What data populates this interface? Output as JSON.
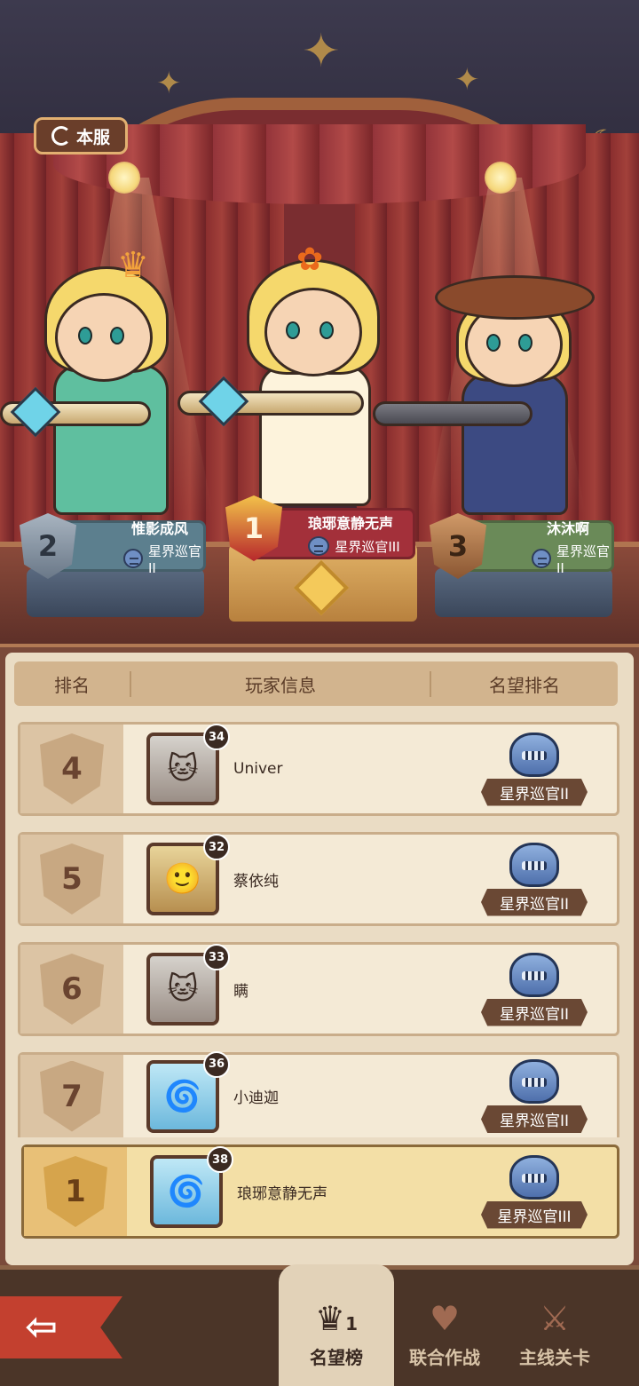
{
  "server_button": {
    "label": "本服"
  },
  "podium": {
    "first": {
      "rank": "1",
      "name": "琅琊意静无声",
      "title": "星界巡官III"
    },
    "second": {
      "rank": "2",
      "name": "惟影成风",
      "title": "星界巡官II"
    },
    "third": {
      "rank": "3",
      "name": "沐沐啊",
      "title": "星界巡官II"
    }
  },
  "list_header": {
    "rank": "排名",
    "info": "玩家信息",
    "fame": "名望排名"
  },
  "rows": [
    {
      "rank": "4",
      "level": "34",
      "name": "Univer",
      "title": "星界巡官II",
      "avatar": "gray-cat"
    },
    {
      "rank": "5",
      "level": "32",
      "name": "蔡依纯",
      "title": "星界巡官II",
      "avatar": "blonde-boy"
    },
    {
      "rank": "6",
      "level": "33",
      "name": "瞒",
      "title": "星界巡官II",
      "avatar": "gray-cat"
    },
    {
      "rank": "7",
      "level": "36",
      "name": "小迪迦",
      "title": "星界巡官II",
      "avatar": "blue-hair"
    }
  ],
  "self_row": {
    "rank": "1",
    "level": "38",
    "name": "琅琊意静无声",
    "title": "星界巡官III",
    "avatar": "blue-hair"
  },
  "nav": {
    "tab_fame": "名望榜",
    "tab_coop": "联合作战",
    "tab_main": "主线关卡",
    "fame_icon_rank": "1"
  },
  "colors": {
    "accent_red": "#c3402f",
    "gold": "#f2c24a",
    "panel_bg": "#eadcc4"
  }
}
